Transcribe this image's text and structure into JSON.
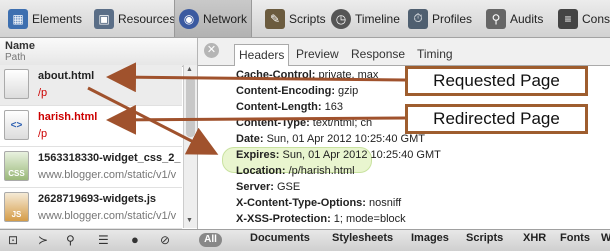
{
  "toolbar": {
    "items": [
      {
        "label": "Elements",
        "icon": "elements-icon"
      },
      {
        "label": "Resources",
        "icon": "resources-icon"
      },
      {
        "label": "Network",
        "icon": "network-icon"
      },
      {
        "label": "Scripts",
        "icon": "scripts-icon"
      },
      {
        "label": "Timeline",
        "icon": "timeline-icon"
      },
      {
        "label": "Profiles",
        "icon": "profiles-icon"
      },
      {
        "label": "Audits",
        "icon": "audits-icon"
      },
      {
        "label": "Conso",
        "icon": "console-icon"
      }
    ],
    "active": "Network"
  },
  "left_panel": {
    "col_name": "Name",
    "col_path": "Path",
    "rows": [
      {
        "name": "about.html",
        "path": "/p",
        "name_color": "#222222",
        "path_color": "#cc0000"
      },
      {
        "name": "harish.html",
        "path": "/p",
        "name_color": "#cc0000",
        "path_color": "#cc0000",
        "icon_text": "<>"
      },
      {
        "name": "1563318330-widget_css_2_",
        "path": "www.blogger.com/static/v1/v",
        "name_color": "#222222",
        "path_color": "#777777",
        "icon_text": "CSS"
      },
      {
        "name": "2628719693-widgets.js",
        "path": "www.blogger.com/static/v1/v",
        "name_color": "#222222",
        "path_color": "#777777",
        "icon_text": "JS"
      }
    ]
  },
  "detail": {
    "tabs": [
      "Headers",
      "Preview",
      "Response",
      "Timing"
    ],
    "active_tab": "Headers",
    "headers": [
      {
        "key": "Cache-Control:",
        "value": "private, max"
      },
      {
        "key": "Content-Encoding:",
        "value": "gzip"
      },
      {
        "key": "Content-Length:",
        "value": "163"
      },
      {
        "key": "Content-Type:",
        "value": "text/html; ch"
      },
      {
        "key": "Date:",
        "value": "Sun, 01 Apr 2012 10:25:40 GMT"
      },
      {
        "key": "Expires:",
        "value": "Sun, 01 Apr 2012 10:25:40 GMT"
      },
      {
        "key": "Location:",
        "value": "/p/harish.html"
      },
      {
        "key": "Server:",
        "value": "GSE"
      },
      {
        "key": "X-Content-Type-Options:",
        "value": "nosniff"
      },
      {
        "key": "X-XSS-Protection:",
        "value": "1; mode=block"
      }
    ]
  },
  "callouts": {
    "requested": "Requested Page",
    "redirected": "Redirected Page",
    "border_color": "#9e5d2e"
  },
  "statusbar": {
    "all_label": "All",
    "filters": [
      "Documents",
      "Stylesheets",
      "Images",
      "Scripts",
      "XHR",
      "Fonts",
      "W"
    ]
  },
  "colors": {
    "accent": "#cc0000",
    "arrow": "#a0522d",
    "highlight": "#e9f5cf"
  }
}
